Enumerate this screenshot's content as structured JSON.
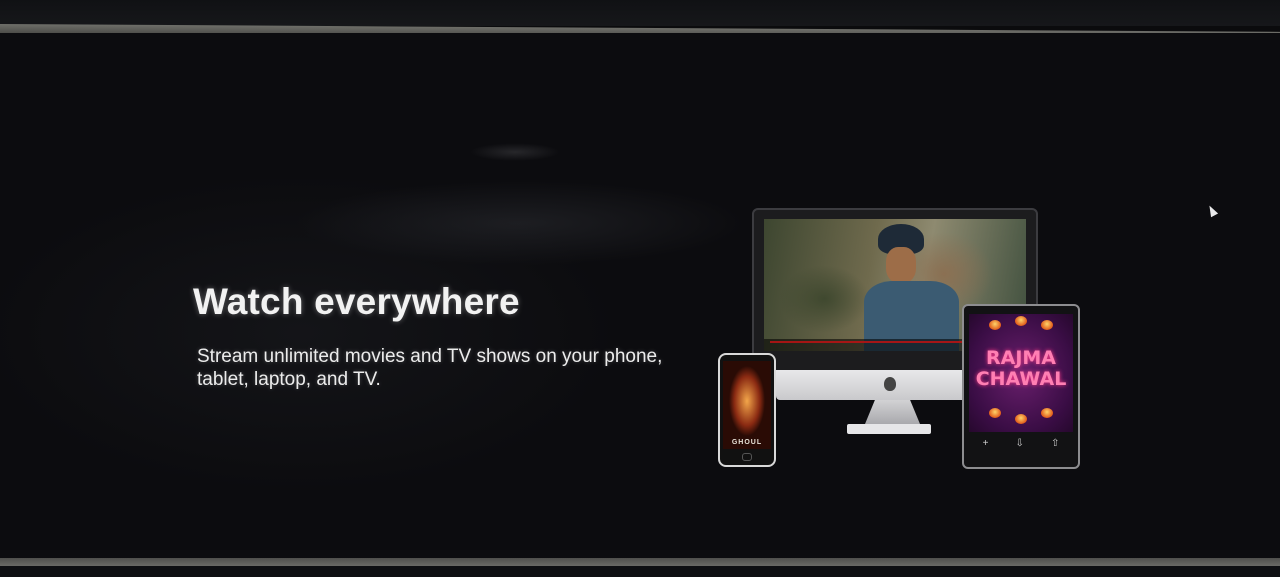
{
  "hero": {
    "title": "Watch everywhere",
    "description": "Stream unlimited movies and TV shows on your phone, tablet, laptop, and TV."
  },
  "devices": {
    "phone_poster_title": "GHOUL",
    "tablet_poster_title_line1": "RAJMA",
    "tablet_poster_title_line2": "CHAWAL"
  },
  "colors": {
    "background": "#0c0c0f",
    "text": "#f2f2f2",
    "player_progress": "#b41414"
  }
}
